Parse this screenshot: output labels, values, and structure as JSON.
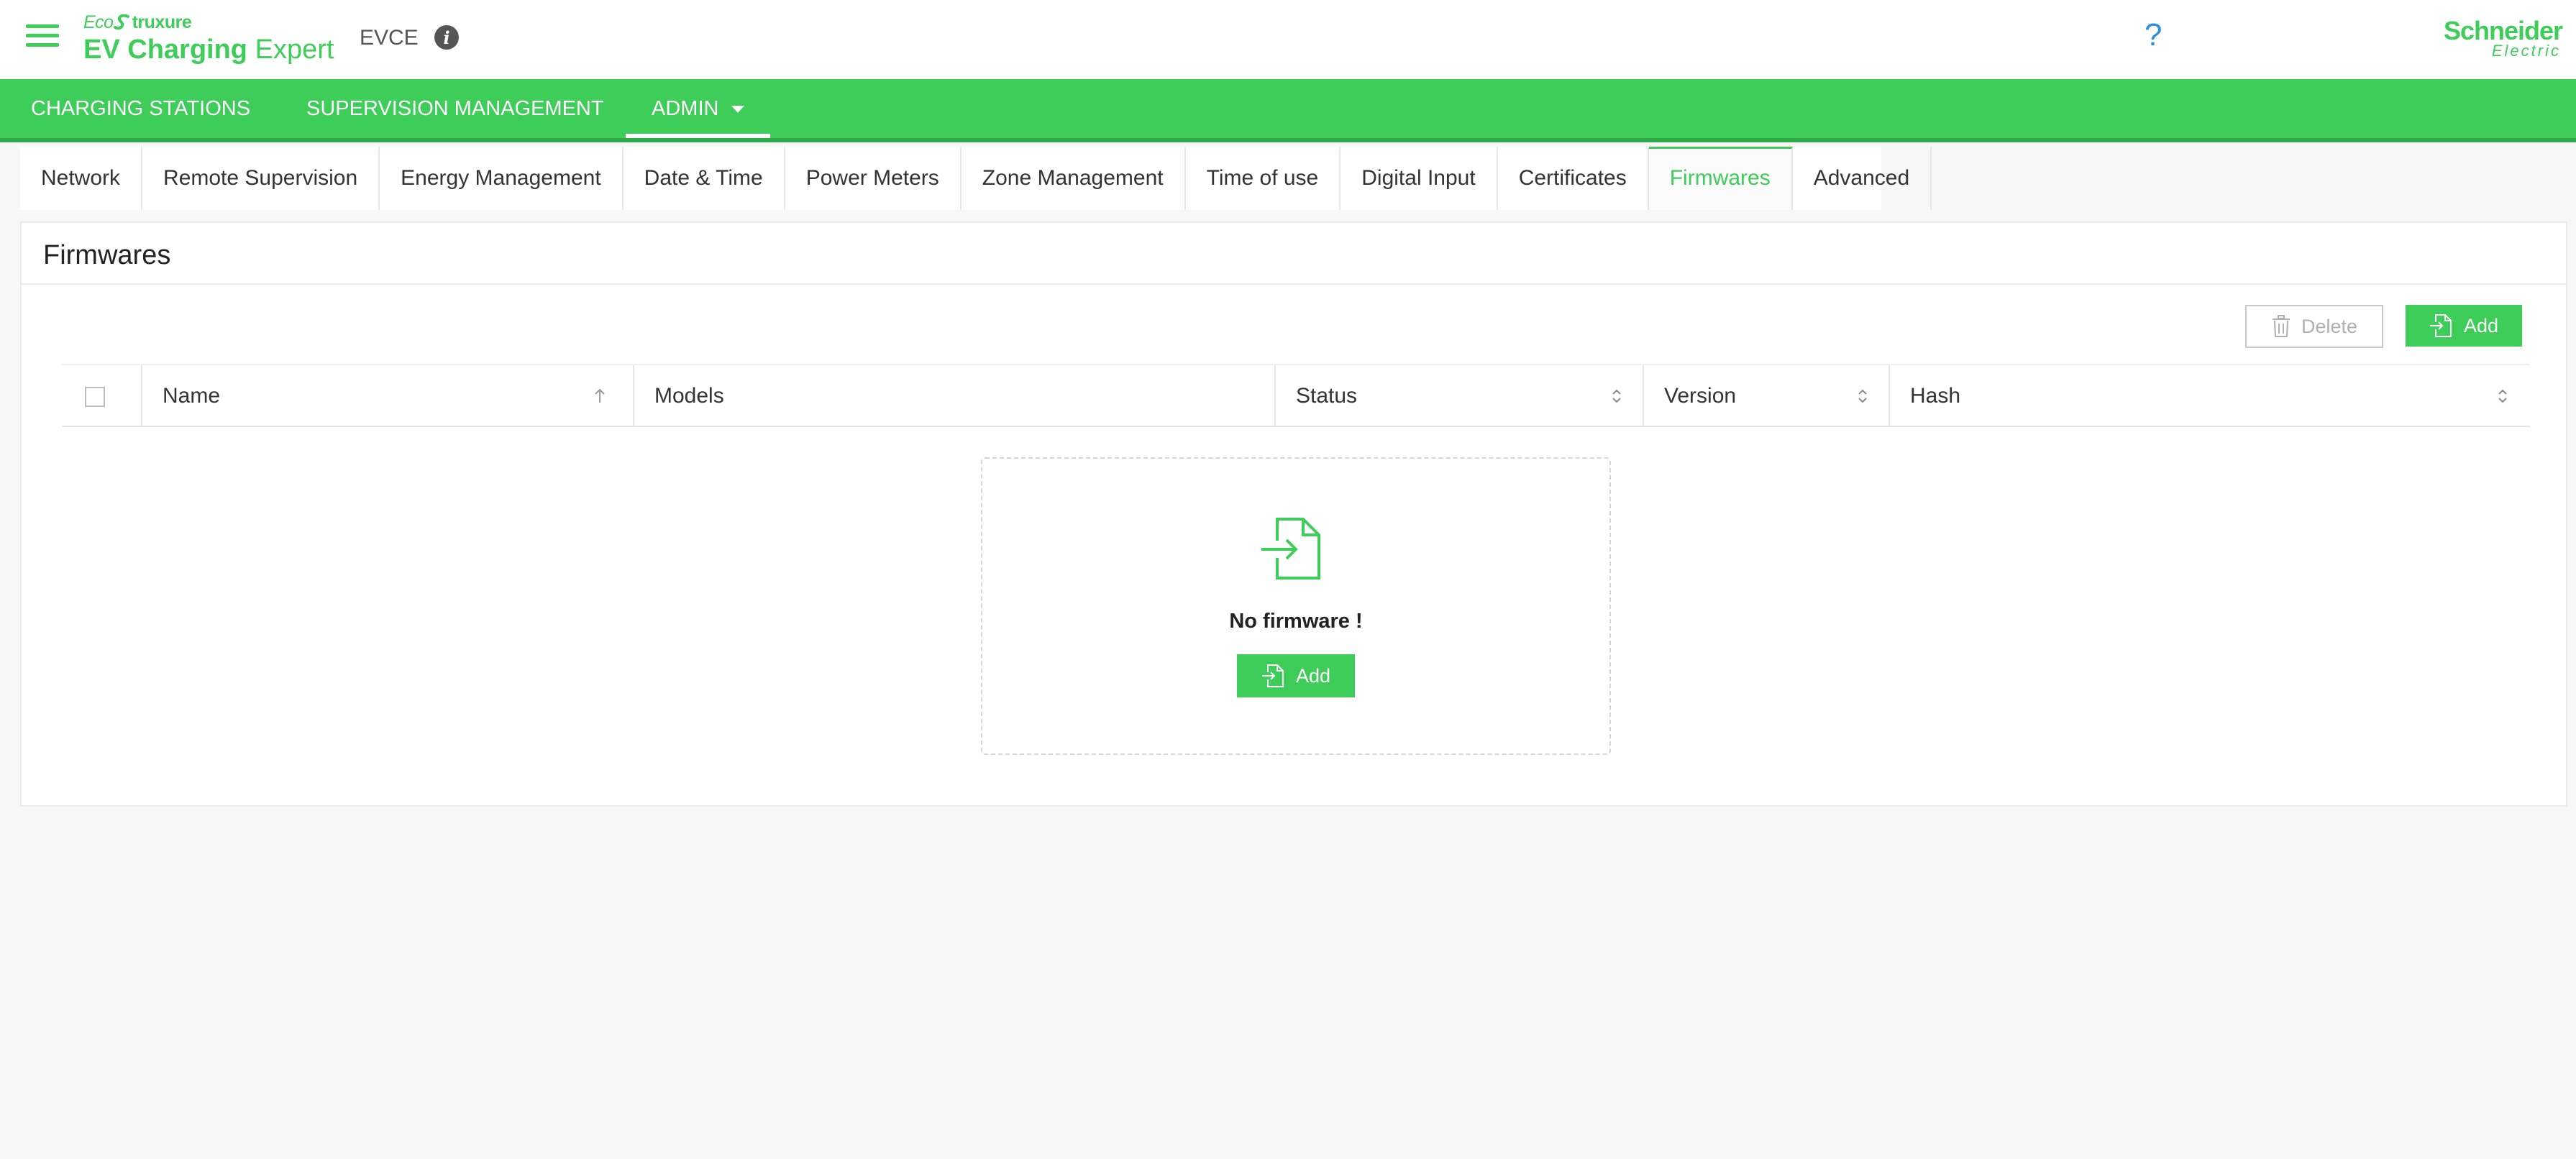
{
  "header": {
    "brand_eco": "Eco",
    "brand_struxure": "truxure",
    "brand_ev": "EV Charging",
    "brand_expert": "Expert",
    "site_name": "EVCE",
    "help_symbol": "?",
    "logo_line1": "Schneider",
    "logo_line2": "Electric",
    "icons": [
      "hamburger-menu-icon",
      "info-icon",
      "help-icon",
      "schneider-logo"
    ]
  },
  "nav": {
    "charging_stations": "CHARGING STATIONS",
    "supervision_management": "SUPERVISION MANAGEMENT",
    "admin": "ADMIN"
  },
  "tabs": [
    {
      "label": "Network"
    },
    {
      "label": "Remote Supervision"
    },
    {
      "label": "Energy Management"
    },
    {
      "label": "Date & Time"
    },
    {
      "label": "Power Meters"
    },
    {
      "label": "Zone Management"
    },
    {
      "label": "Time of use"
    },
    {
      "label": "Digital Input"
    },
    {
      "label": "Certificates"
    },
    {
      "label": "Firmwares",
      "active": true
    },
    {
      "label": "Advanced"
    }
  ],
  "panel": {
    "title": "Firmwares",
    "delete_label": "Delete",
    "add_label": "Add"
  },
  "table": {
    "columns": [
      "Name",
      "Models",
      "Status",
      "Version",
      "Hash"
    ]
  },
  "empty_state": {
    "message": "No firmware !",
    "add_label": "Add"
  },
  "colors": {
    "brand_green": "#3dcd58",
    "nav_green_dark": "#2ea748",
    "help_blue": "#2b8fe0",
    "background": "#f7f7f7"
  }
}
